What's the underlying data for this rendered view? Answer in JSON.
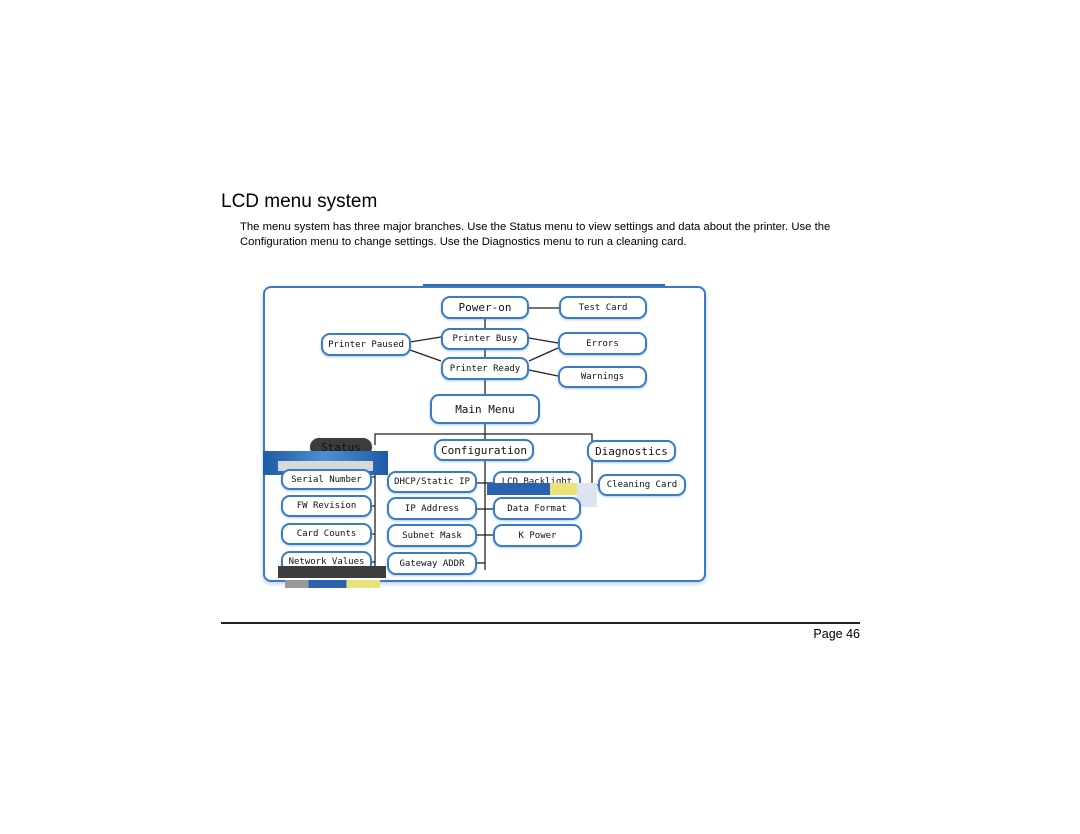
{
  "page": {
    "title": "LCD menu system",
    "intro": "The menu system has three major branches. Use the Status menu to view settings and data about the printer. Use the Configuration menu to change settings. Use the Diagnostics menu to run a cleaning card.",
    "page_number": "Page 46"
  },
  "diagram": {
    "accent_color": "#3a7cc4",
    "nodes": {
      "power_on": "Power-on",
      "test_card": "Test Card",
      "printer_busy": "Printer Busy",
      "printer_paused": "Printer Paused",
      "errors": "Errors",
      "printer_ready": "Printer Ready",
      "warnings": "Warnings",
      "main_menu": "Main Menu",
      "status": "Status",
      "configuration": "Configuration",
      "diagnostics": "Diagnostics",
      "serial_number": "Serial Number",
      "fw_revision": "FW Revision",
      "card_counts": "Card Counts",
      "network_values": "Network Values",
      "dhcp_static_ip": "DHCP/Static IP",
      "ip_address": "IP Address",
      "subnet_mask": "Subnet Mask",
      "gateway_addr": "Gateway ADDR",
      "lcd_backlight": "LCD Backlight",
      "data_format": "Data Format",
      "k_power": "K Power",
      "cleaning_card": "Cleaning Card"
    }
  }
}
